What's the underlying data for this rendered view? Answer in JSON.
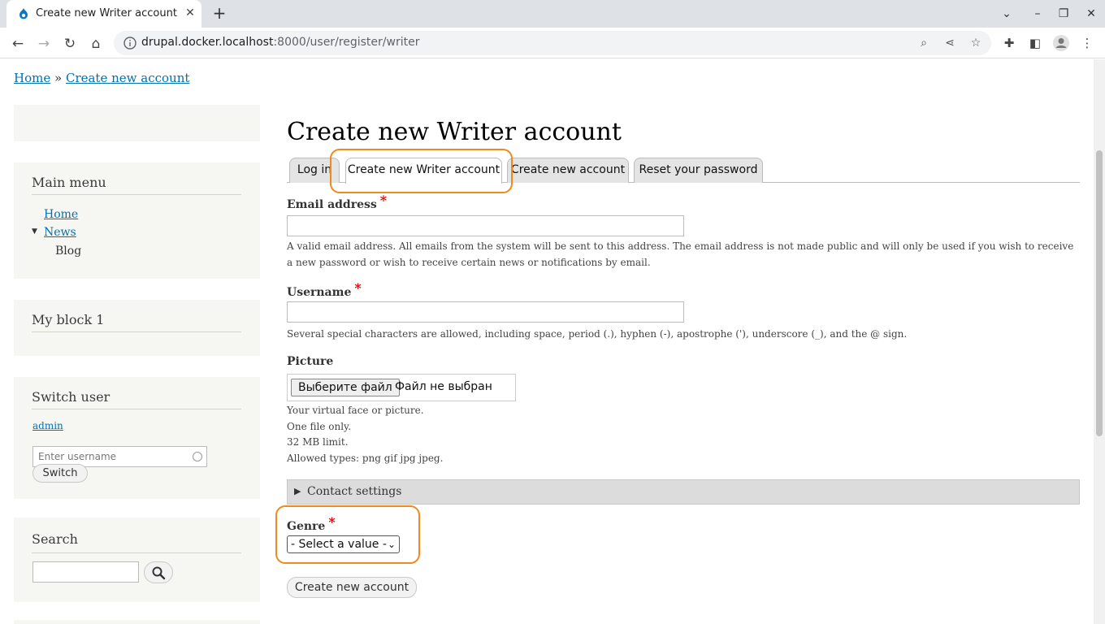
{
  "browser": {
    "tab_title": "Create new Writer account | f",
    "url_host": "drupal.docker.localhost",
    "url_rest": ":8000/user/register/writer"
  },
  "breadcrumb": {
    "home": "Home",
    "separator": "»",
    "current": "Create new account"
  },
  "sidebar": {
    "main_menu": {
      "title": "Main menu",
      "items": [
        "Home",
        "News",
        "Blog"
      ]
    },
    "my_block": {
      "title": "My block 1"
    },
    "switch_user": {
      "title": "Switch user",
      "user_link": "admin",
      "input_placeholder": "Enter username",
      "button": "Switch"
    },
    "search": {
      "title": "Search"
    }
  },
  "main": {
    "title": "Create new Writer account",
    "tabs": [
      {
        "label": "Log in"
      },
      {
        "label": "Create new Writer account",
        "active": true
      },
      {
        "label": "Create new account"
      },
      {
        "label": "Reset your password"
      }
    ],
    "email": {
      "label": "Email address",
      "required_mark": "*",
      "description": "A valid email address. All emails from the system will be sent to this address. The email address is not made public and will only be used if you wish to receive a new password or wish to receive certain news or notifications by email."
    },
    "username": {
      "label": "Username",
      "required_mark": "*",
      "description": "Several special characters are allowed, including space, period (.), hyphen (-), apostrophe ('), underscore (_), and the @ sign."
    },
    "picture": {
      "label": "Picture",
      "button": "Выберите файл",
      "status": "Файл не выбран",
      "desc_lines": [
        "Your virtual face or picture.",
        "One file only.",
        "32 MB limit.",
        "Allowed types: png gif jpg jpeg."
      ]
    },
    "contact_settings": "Contact settings",
    "genre": {
      "label": "Genre",
      "required_mark": "*",
      "selected": "- Select a value -"
    },
    "submit": "Create new account"
  },
  "colors": {
    "link": "#0071b3",
    "highlight": "#f08a1c",
    "required": "#ee0000",
    "sidebar_bg": "#f6f6f2"
  }
}
